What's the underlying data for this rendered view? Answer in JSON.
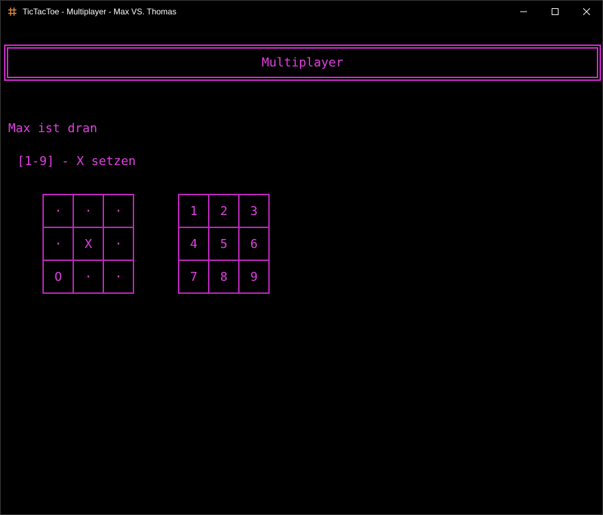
{
  "window": {
    "title": "TicTacToe - Multiplayer - Max VS. Thomas",
    "app_icon": "hash-icon",
    "controls": [
      "minimize-icon",
      "maximize-icon",
      "close-icon"
    ]
  },
  "colors": {
    "accent": "#e040e0",
    "border": "#c028c0",
    "background": "#000000"
  },
  "header": {
    "title": "Multiplayer"
  },
  "status": {
    "turn_text": "Max ist dran",
    "hint_text": "[1-9] - X setzen"
  },
  "board": {
    "cells": [
      "·",
      "·",
      "·",
      "·",
      "X",
      "·",
      "O",
      "·",
      "·"
    ]
  },
  "key_grid": {
    "cells": [
      "1",
      "2",
      "3",
      "4",
      "5",
      "6",
      "7",
      "8",
      "9"
    ]
  }
}
